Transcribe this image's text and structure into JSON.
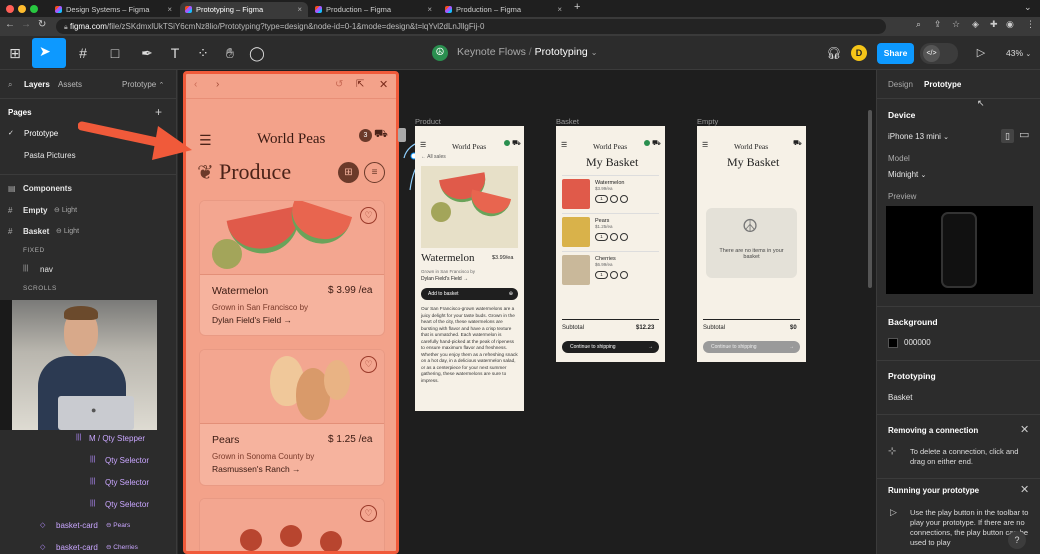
{
  "browser": {
    "tabs": [
      "Design Systems – Figma",
      "Prototyping – Figma",
      "Production – Figma",
      "Production – Figma"
    ],
    "url_host": "figma.com",
    "url_path": "/file/zSKdmxlUkTSiY6cmNz8lio/Prototyping?type=design&node-id=0-1&mode=design&t=lqYvl2dLnJllgFij-0"
  },
  "toolbar": {
    "project": "Keynote Flows",
    "file": "Prototyping",
    "avatar": "D",
    "share": "Share",
    "zoom": "43%"
  },
  "left_panel": {
    "tabs": [
      "Layers",
      "Assets"
    ],
    "page_select": "Prototype",
    "pages_title": "Pages",
    "pages": [
      "Prototype",
      "Pasta Pictures"
    ],
    "layers": [
      {
        "name": "Components",
        "badge": ""
      },
      {
        "name": "Empty",
        "badge": "Light"
      },
      {
        "name": "Basket",
        "badge": "Light"
      }
    ],
    "fixed": "FIXED",
    "nav": "nav",
    "scrolls": "SCROLLS",
    "lower_layers": [
      "M / Qty Stepper",
      "Qty Selector",
      "Qty Selector",
      "Qty Selector"
    ],
    "basket_cards": [
      {
        "name": "basket-card",
        "badge": "Pears"
      },
      {
        "name": "basket-card",
        "badge": "Cherries"
      }
    ]
  },
  "prototype_view": {
    "brand": "World Peas",
    "cart_count": "3",
    "heading": "Produce",
    "products": [
      {
        "name": "Watermelon",
        "price": "$ 3.99 /ea",
        "origin": "Grown in San Francisco by",
        "farm": "Dylan Field's Field →"
      },
      {
        "name": "Pears",
        "price": "$ 1.25 /ea",
        "origin": "Grown in Sonoma County by",
        "farm": "Rasmussen's Ranch →"
      }
    ]
  },
  "frames": {
    "product": {
      "label": "Product",
      "brand": "World Peas",
      "back": "← All sales",
      "name": "Watermelon",
      "price": "$3.99/ea",
      "origin": "Grown in San Francisco by",
      "farm": "Dylan Field's Field →",
      "cta": "Add to basket",
      "desc": "Our San Francisco-grown watermelons are a juicy delight for your taste buds. Grown in the heart of the city, these watermelons are bursting with flavor and have a crisp texture that is unmatched. Each watermelon is carefully hand-picked at the peak of ripeness to ensure maximum flavor and freshness. Whether you enjoy them as a refreshing snack on a hot day, in a delicious watermelon salad, or as a centerpiece for your next summer gathering, these watermelons are sure to impress."
    },
    "basket": {
      "label": "Basket",
      "brand": "World Peas",
      "title": "My Basket",
      "items": [
        {
          "name": "Watermelon",
          "price": "$3.99/ea",
          "qty": "1"
        },
        {
          "name": "Pears",
          "price": "$1.25/ea",
          "qty": "1"
        },
        {
          "name": "Cherries",
          "price": "$6.99/ea",
          "qty": "1"
        }
      ],
      "subtotal_label": "Subtotal",
      "subtotal": "$12.23",
      "cta": "Continue to shipping"
    },
    "empty": {
      "label": "Empty",
      "brand": "World Peas",
      "title": "My Basket",
      "message": "There are no items in your basket",
      "subtotal_label": "Subtotal",
      "subtotal": "$0",
      "cta": "Continue to shipping"
    }
  },
  "right_panel": {
    "tabs": [
      "Design",
      "Prototype"
    ],
    "device_title": "Device",
    "device": "iPhone 13 mini",
    "model_label": "Model",
    "model": "Midnight",
    "preview_label": "Preview",
    "background_title": "Background",
    "background_value": "000000",
    "prototyping_title": "Prototyping",
    "prototyping_value": "Basket",
    "removing_title": "Removing a connection",
    "removing_text": "To delete a connection, click and drag on either end.",
    "running_title": "Running your prototype",
    "running_text": "Use the play button in the toolbar to play your prototype. If there are no connections, the play button can be used to play"
  }
}
